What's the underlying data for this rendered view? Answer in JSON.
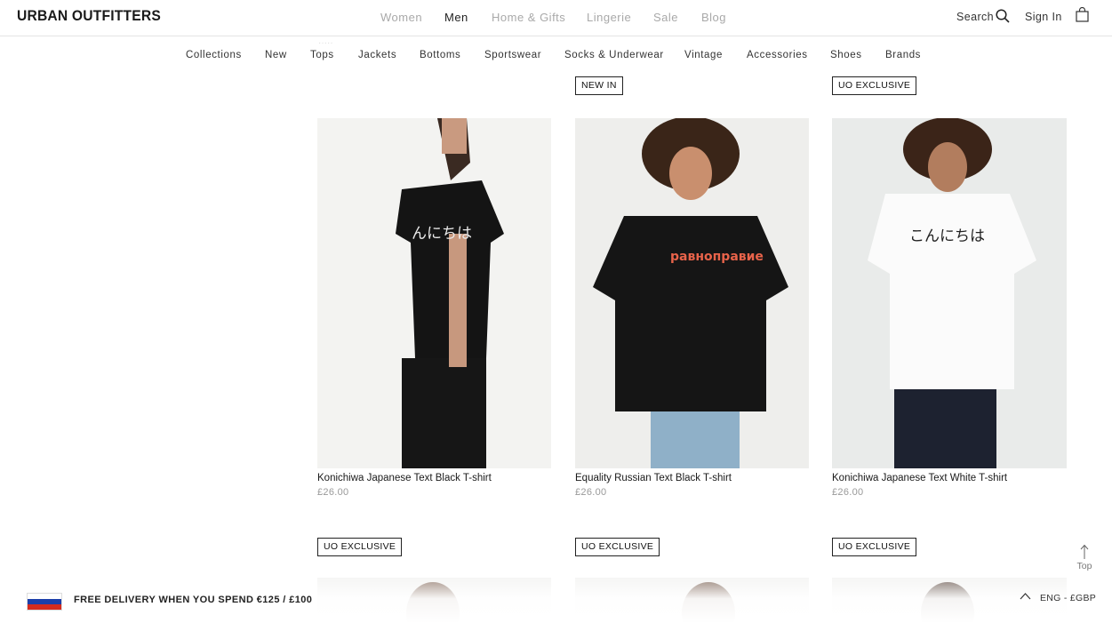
{
  "header": {
    "logo": "URBAN OUTFITTERS",
    "main_nav": [
      "Women",
      "Men",
      "Home & Gifts",
      "Lingerie",
      "Sale",
      "Blog"
    ],
    "active_nav": "Men",
    "search_label": "Search",
    "sign_in_label": "Sign In"
  },
  "subnav": [
    "Collections",
    "New",
    "Tops",
    "Jackets",
    "Bottoms",
    "Sportswear",
    "Socks & Underwear",
    "Vintage",
    "Accessories",
    "Shoes",
    "Brands"
  ],
  "products": [
    {
      "badge": "",
      "name": "Konichiwa Japanese Text Black T-shirt",
      "price": "£26.00",
      "shirt_text": "んにちは",
      "shirt_color": "#141414",
      "print_color": "#e9e9e9"
    },
    {
      "badge": "NEW IN",
      "name": "Equality Russian Text Black T-shirt",
      "price": "£26.00",
      "shirt_text": "равноправие",
      "shirt_color": "#151515",
      "print_color": "#e8634a"
    },
    {
      "badge": "UO EXCLUSIVE",
      "name": "Konichiwa Japanese Text White T-shirt",
      "price": "£26.00",
      "shirt_text": "こんにちは",
      "shirt_color": "#fbfbfb",
      "print_color": "#222222"
    }
  ],
  "next_row_badges": [
    "UO EXCLUSIVE",
    "UO EXCLUSIVE",
    "UO EXCLUSIVE"
  ],
  "footer": {
    "promo": "FREE DELIVERY WHEN YOU SPEND €125 / £100",
    "locale": "ENG - £GBP",
    "top_label": "Top",
    "flag_colors": [
      "#ffffff",
      "#1c3faa",
      "#d52b1e"
    ]
  }
}
